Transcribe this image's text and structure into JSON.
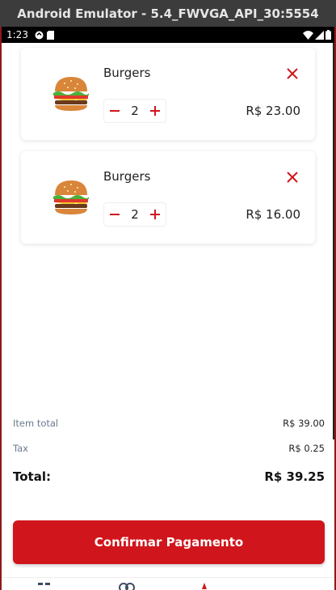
{
  "window": {
    "title": "Android Emulator - 5.4_FWVGA_API_30:5554"
  },
  "status_bar": {
    "time": "1:23"
  },
  "cart": {
    "items": [
      {
        "name": "Burgers",
        "quantity": "2",
        "price": "R$ 23.00"
      },
      {
        "name": "Burgers",
        "quantity": "2",
        "price": "R$ 16.00"
      }
    ]
  },
  "summary": {
    "item_total_label": "Item total",
    "item_total_value": "R$ 39.00",
    "tax_label": "Tax",
    "tax_value": "R$ 0.25",
    "total_label": "Total:",
    "total_value": "R$ 39.25"
  },
  "confirm_button": {
    "label": "Confirmar Pagamento"
  },
  "colors": {
    "accent": "#d0161c",
    "muted_text": "#6b7a90"
  },
  "icons": [
    "close-icon",
    "minus-icon",
    "plus-icon",
    "burger-icon",
    "wifi-icon",
    "signal-icon",
    "battery-icon"
  ]
}
